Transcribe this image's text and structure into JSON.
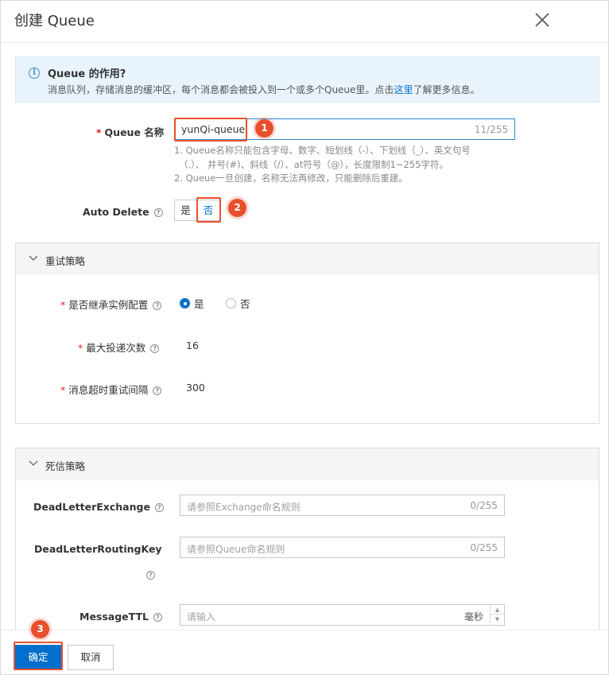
{
  "dialog": {
    "title": "创建 Queue",
    "close_icon": "close-icon"
  },
  "notice": {
    "icon": "info-icon",
    "title": "Queue 的作用?",
    "body_before": "消息队列，存储消息的缓冲区，每个消息都会被投入到一个或多个Queue里。点击",
    "link": "这里",
    "body_after": "了解更多信息。"
  },
  "queue_name": {
    "required_mark": "*",
    "label": "Queue 名称",
    "value": "yunQi-queue",
    "counter": "11/255",
    "hint_line1": "1. Queue名称只能包含字母、数字、短划线（-）、下划线（_）、英文句号",
    "hint_line2": "（.）、 井号(#)、斜线（/）、at符号（@），长度限制1~255字符。",
    "hint_line3": "2. Queue一旦创建，名称无法再修改，只能删除后重建。"
  },
  "auto_delete": {
    "label": "Auto Delete",
    "options": [
      "是",
      "否"
    ],
    "selected": "否"
  },
  "retry_panel": {
    "title": "重试策略",
    "inherit": {
      "required_mark": "*",
      "label": "是否继承实例配置",
      "options": [
        "是",
        "否"
      ],
      "selected": "是"
    },
    "max_delivery": {
      "required_mark": "*",
      "label": "最大投递次数",
      "value": "16"
    },
    "timeout_interval": {
      "required_mark": "*",
      "label": "消息超时重试间隔",
      "value": "300"
    }
  },
  "dead_letter_panel": {
    "title": "死信策略",
    "exchange": {
      "label": "DeadLetterExchange",
      "placeholder": "请参照Exchange命名规则",
      "counter": "0/255"
    },
    "routing_key": {
      "label": "DeadLetterRoutingKey",
      "placeholder": "请参照Queue命名规则",
      "counter": "0/255"
    },
    "ttl": {
      "label": "MessageTTL",
      "placeholder": "请输入",
      "unit": "毫秒"
    }
  },
  "footer": {
    "confirm": "确定",
    "cancel": "取消"
  },
  "annotations": {
    "badge1": "1",
    "badge2": "2",
    "badge3": "3",
    "highlight_color": "#e8502d"
  },
  "colors": {
    "accent": "#0070cc",
    "required": "#e02020",
    "notice_bg": "#e8f3fc"
  }
}
